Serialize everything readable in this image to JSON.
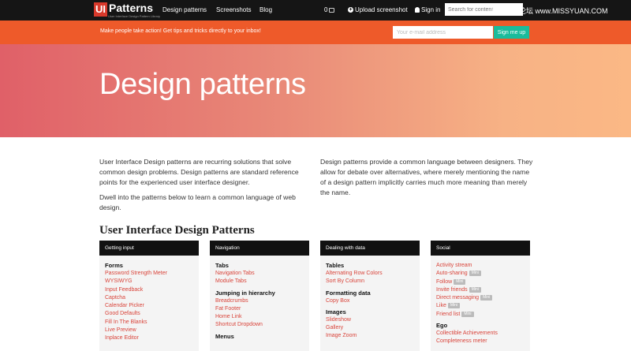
{
  "nav": {
    "logo_ui": "UI",
    "logo_text": "Patterns",
    "logo_tagline": "User Interface Design Pattern Library",
    "links": [
      "Design patterns",
      "Screenshots",
      "Blog"
    ],
    "count": "0",
    "upload": "Upload screenshot",
    "signin": "Sign in",
    "search_placeholder": "Search for content",
    "watermark": "思缘设计论坛 www.MISSYUAN.COM"
  },
  "promo": {
    "text": "Make people take action! Get tips and tricks directly to your inbox!",
    "email_placeholder": "Your e-mail address",
    "button": "Sign me up"
  },
  "hero": {
    "title": "Design patterns"
  },
  "intro": {
    "left_p1": "User Interface Design patterns are recurring solutions that solve common design problems. Design patterns are standard reference points for the experienced user interface designer.",
    "left_p2": "Dwell into the patterns below to learn a common language of web design.",
    "right_p1": "Design patterns provide a common language between designers. They allow for debate over alternatives, where merely mentioning the name of a design pattern implicitly carries much more meaning than merely the name."
  },
  "section_title": "User Interface Design Patterns",
  "mini_label": "Mini",
  "colors": {
    "accent": "#d9443a",
    "promo": "#ee5a2a",
    "signup": "#1abc9c",
    "nav": "#151515"
  },
  "categories": [
    {
      "title": "Getting input",
      "groups": [
        {
          "title": "Forms",
          "items": [
            "Password Strength Meter",
            "WYSIWYG",
            "Input Feedback",
            "Captcha",
            "Calendar Picker",
            "Good Defaults",
            "Fill In The Blanks",
            "Live Preview",
            "Inplace Editor"
          ]
        }
      ]
    },
    {
      "title": "Navigation",
      "groups": [
        {
          "title": "Tabs",
          "items": [
            "Navigation Tabs",
            "Module Tabs"
          ]
        },
        {
          "title": "Jumping in hierarchy",
          "items": [
            "Breadcrumbs",
            "Fat Footer",
            "Home Link",
            "Shortcut Dropdown"
          ]
        },
        {
          "title": "Menus",
          "items": []
        }
      ]
    },
    {
      "title": "Dealing with data",
      "groups": [
        {
          "title": "Tables",
          "items": [
            "Alternating Row Colors",
            "Sort By Column"
          ]
        },
        {
          "title": "Formatting data",
          "items": [
            "Copy Box"
          ]
        },
        {
          "title": "Images",
          "items": [
            "Slideshow",
            "Gallery",
            "Image Zoom"
          ]
        }
      ]
    },
    {
      "title": "Social",
      "groups": [
        {
          "title": "",
          "items": [
            "Activity stream",
            "Auto-sharing",
            "Follow",
            "Invite friends",
            "Direct messaging",
            "Like",
            "Friend list"
          ],
          "mini": [
            false,
            true,
            true,
            true,
            true,
            true,
            true
          ]
        },
        {
          "title": "Ego",
          "items": [
            "Collectible Achievements",
            "Completeness meter"
          ]
        }
      ]
    }
  ]
}
